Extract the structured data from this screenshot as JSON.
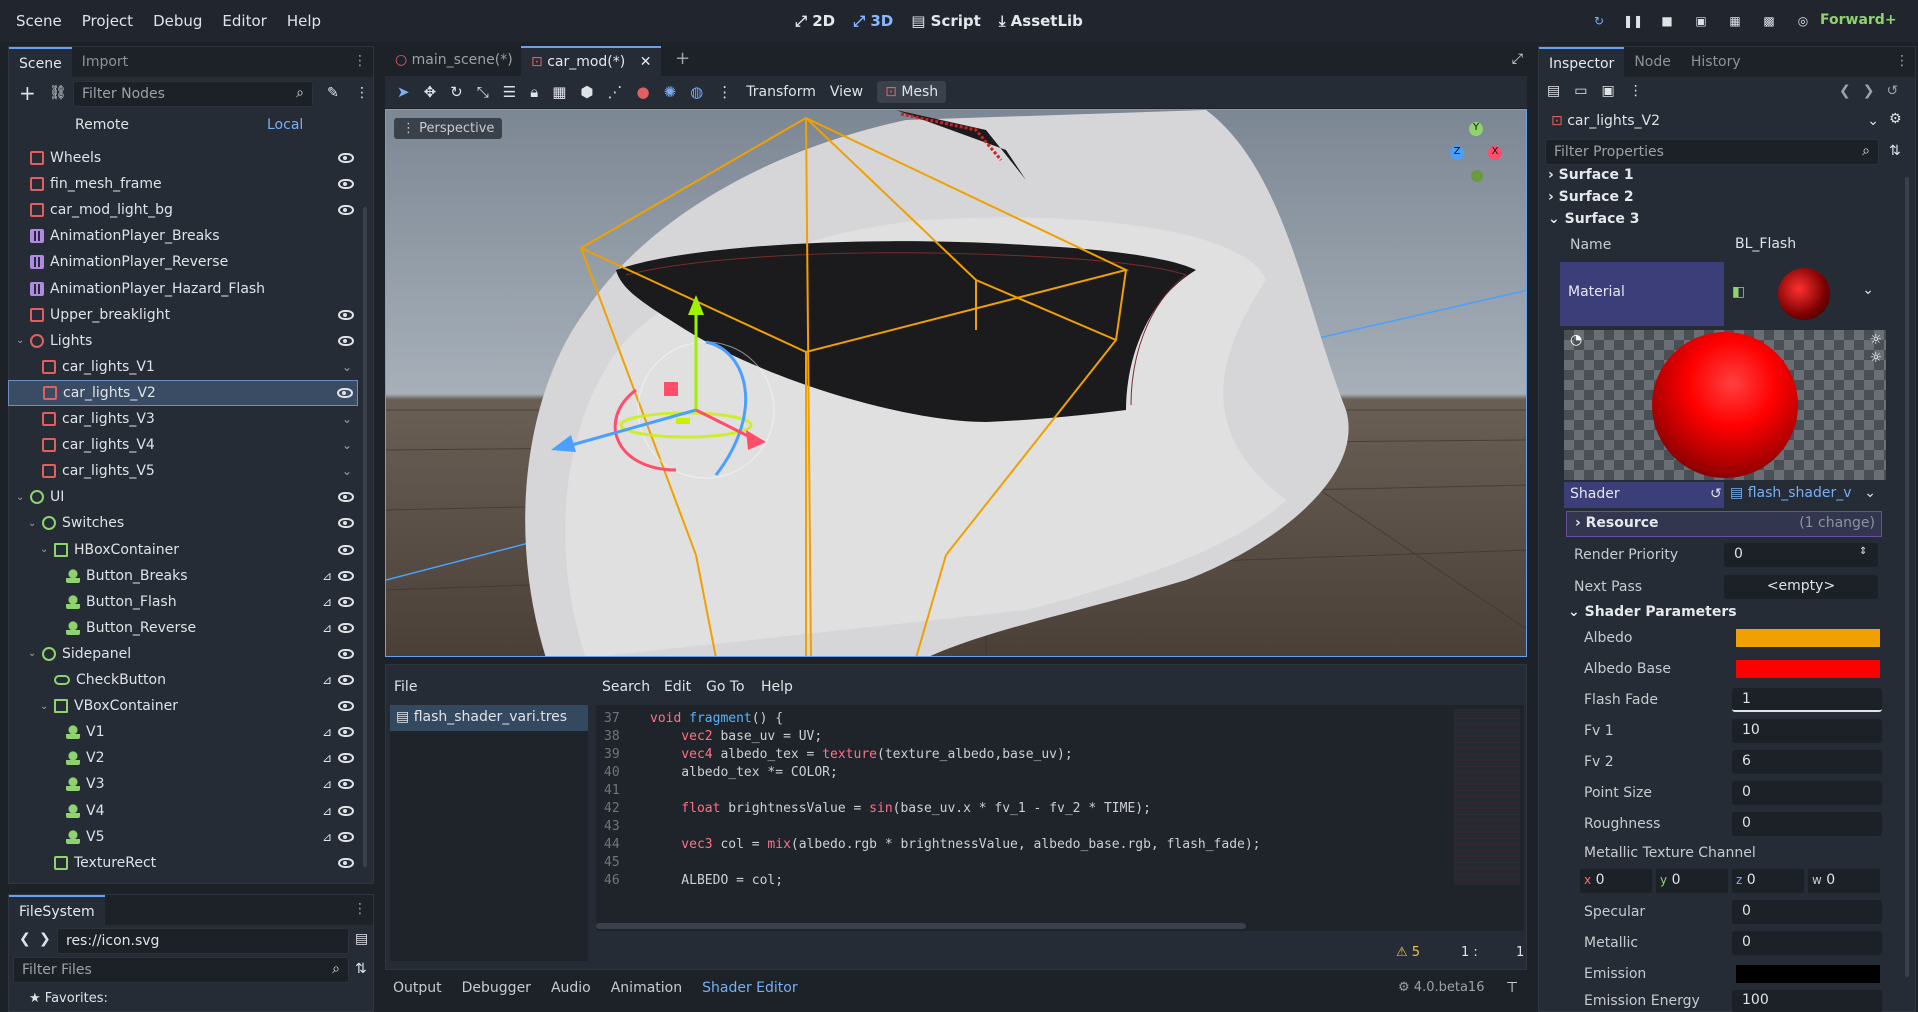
{
  "menu": [
    "Scene",
    "Project",
    "Debug",
    "Editor",
    "Help"
  ],
  "modes": [
    "2D",
    "3D",
    "Script",
    "AssetLib"
  ],
  "renderer": "Forward+",
  "scene_panel": {
    "tabs": [
      "Scene",
      "Import"
    ],
    "filter_placeholder": "Filter Nodes",
    "remote": "Remote",
    "local": "Local",
    "nodes": [
      {
        "label": "Wheels",
        "indent": 1,
        "icon": "mesh",
        "eye": true
      },
      {
        "label": "fin_mesh_frame",
        "indent": 1,
        "icon": "mesh",
        "eye": true
      },
      {
        "label": "car_mod_light_bg",
        "indent": 1,
        "icon": "mesh",
        "eye": true
      },
      {
        "label": "AnimationPlayer_Breaks",
        "indent": 1,
        "icon": "anim",
        "eye": false
      },
      {
        "label": "AnimationPlayer_Reverse",
        "indent": 1,
        "icon": "anim",
        "eye": false
      },
      {
        "label": "AnimationPlayer_Hazard_Flash",
        "indent": 1,
        "icon": "anim",
        "eye": false
      },
      {
        "label": "Upper_breaklight",
        "indent": 1,
        "icon": "mesh",
        "eye": true
      },
      {
        "label": "Lights",
        "indent": 1,
        "icon": "light",
        "eye": true,
        "arrow": "v"
      },
      {
        "label": "car_lights_V1",
        "indent": 2,
        "icon": "mesh",
        "eye": false,
        "chev": true
      },
      {
        "label": "car_lights_V2",
        "indent": 2,
        "icon": "mesh",
        "eye": true,
        "selected": true
      },
      {
        "label": "car_lights_V3",
        "indent": 2,
        "icon": "mesh",
        "eye": false,
        "chev": true
      },
      {
        "label": "car_lights_V4",
        "indent": 2,
        "icon": "mesh",
        "eye": false,
        "chev": true
      },
      {
        "label": "car_lights_V5",
        "indent": 2,
        "icon": "mesh",
        "eye": false,
        "chev": true
      },
      {
        "label": "UI",
        "indent": 1,
        "icon": "ctl",
        "eye": true,
        "arrow": "v"
      },
      {
        "label": "Switches",
        "indent": 2,
        "icon": "ctl",
        "eye": true,
        "arrow": "v"
      },
      {
        "label": "HBoxContainer",
        "indent": 3,
        "icon": "hbox",
        "eye": true,
        "arrow": "v"
      },
      {
        "label": "Button_Breaks",
        "indent": 4,
        "icon": "btn",
        "eye": true,
        "sig": true
      },
      {
        "label": "Button_Flash",
        "indent": 4,
        "icon": "btn",
        "eye": true,
        "sig": true
      },
      {
        "label": "Button_Reverse",
        "indent": 4,
        "icon": "btn",
        "eye": true,
        "sig": true
      },
      {
        "label": "Sidepanel",
        "indent": 2,
        "icon": "ctl",
        "eye": true,
        "arrow": "v"
      },
      {
        "label": "CheckButton",
        "indent": 3,
        "icon": "chk",
        "eye": true,
        "sig": true
      },
      {
        "label": "VBoxContainer",
        "indent": 3,
        "icon": "hbox",
        "eye": true,
        "arrow": "v"
      },
      {
        "label": "V1",
        "indent": 4,
        "icon": "btn",
        "eye": true,
        "sig": true
      },
      {
        "label": "V2",
        "indent": 4,
        "icon": "btn",
        "eye": true,
        "sig": true
      },
      {
        "label": "V3",
        "indent": 4,
        "icon": "btn",
        "eye": true,
        "sig": true
      },
      {
        "label": "V4",
        "indent": 4,
        "icon": "btn",
        "eye": true,
        "sig": true
      },
      {
        "label": "V5",
        "indent": 4,
        "icon": "btn",
        "eye": true,
        "sig": true
      },
      {
        "label": "TextureRect",
        "indent": 3,
        "icon": "tex",
        "eye": true
      }
    ]
  },
  "filesystem": {
    "tab": "FileSystem",
    "path": "res://icon.svg",
    "filter_placeholder": "Filter Files",
    "favorites": "Favorites:"
  },
  "editor_tabs": [
    "main_scene(*)",
    "car_mod(*)"
  ],
  "viewport_toolbar": {
    "transform": "Transform",
    "view": "View",
    "mesh": "Mesh"
  },
  "viewport": {
    "perspective": "Perspective",
    "gizmo_axes": [
      "Y",
      "X",
      "Z"
    ]
  },
  "script_panel": {
    "menus": [
      "File",
      "Search",
      "Edit",
      "Go To",
      "Help"
    ],
    "open_file": "flash_shader_vari.tres",
    "warnings": "5",
    "line_col": "1 :",
    "col": "1",
    "lines": [
      {
        "n": "37",
        "code": [
          [
            "kw",
            "void "
          ],
          [
            "fn",
            "fragment"
          ],
          [
            "tx",
            "() {"
          ]
        ]
      },
      {
        "n": "38",
        "code": [
          [
            "ty",
            "    vec2 "
          ],
          [
            "tx",
            "base_uv = UV;"
          ]
        ]
      },
      {
        "n": "39",
        "code": [
          [
            "ty",
            "    vec4 "
          ],
          [
            "tx",
            "albedo_tex = "
          ],
          [
            "kw",
            "texture"
          ],
          [
            "tx",
            "(texture_albedo,base_uv);"
          ]
        ]
      },
      {
        "n": "40",
        "code": [
          [
            "tx",
            "    albedo_tex *= COLOR;"
          ]
        ]
      },
      {
        "n": "41",
        "code": [
          [
            "tx",
            ""
          ]
        ]
      },
      {
        "n": "42",
        "code": [
          [
            "ty",
            "    float "
          ],
          [
            "tx",
            "brightnessValue = "
          ],
          [
            "kw",
            "sin"
          ],
          [
            "tx",
            "(base_uv.x * fv_1 - fv_2 * TIME);"
          ]
        ]
      },
      {
        "n": "43",
        "code": [
          [
            "tx",
            ""
          ]
        ]
      },
      {
        "n": "44",
        "code": [
          [
            "ty",
            "    vec3 "
          ],
          [
            "tx",
            "col = "
          ],
          [
            "kw",
            "mix"
          ],
          [
            "tx",
            "(albedo.rgb * brightnessValue, albedo_base.rgb, flash_fade);"
          ]
        ]
      },
      {
        "n": "45",
        "code": [
          [
            "tx",
            ""
          ]
        ]
      },
      {
        "n": "46",
        "code": [
          [
            "tx",
            "    ALBEDO = col;"
          ]
        ]
      }
    ]
  },
  "bottom_tabs": [
    "Output",
    "Debugger",
    "Audio",
    "Animation",
    "Shader Editor"
  ],
  "version": "4.0.beta16",
  "inspector": {
    "tabs": [
      "Inspector",
      "Node",
      "History"
    ],
    "node": "car_lights_V2",
    "filter_placeholder": "Filter Properties",
    "surfaces": [
      "Surface 1",
      "Surface 2",
      "Surface 3"
    ],
    "name_label": "Name",
    "name_value": "BL_Flash",
    "material_label": "Material",
    "shader_label": "Shader",
    "shader_value": "flash_shader_v",
    "resource_label": "Resource",
    "resource_change": "(1 change)",
    "render_priority_label": "Render Priority",
    "render_priority": "0",
    "next_pass_label": "Next Pass",
    "next_pass": "<empty>",
    "shader_params_label": "Shader Parameters",
    "albedo_label": "Albedo",
    "albedo_color": "#f0a000",
    "albedo_base_label": "Albedo Base",
    "albedo_base_color": "#ff0000",
    "flash_fade_label": "Flash Fade",
    "flash_fade": "1",
    "fv1_label": "Fv 1",
    "fv1": "10",
    "fv2_label": "Fv 2",
    "fv2": "6",
    "point_size_label": "Point Size",
    "point_size": "0",
    "roughness_label": "Roughness",
    "roughness": "0",
    "metallic_channel_label": "Metallic Texture Channel",
    "channel": {
      "x": "0",
      "y": "0",
      "z": "0",
      "w": "0"
    },
    "specular_label": "Specular",
    "specular": "0",
    "metallic_label": "Metallic",
    "metallic": "0",
    "emission_label": "Emission",
    "emission_color": "#000000",
    "emission_energy_label": "Emission Energy",
    "emission_energy": "100"
  }
}
